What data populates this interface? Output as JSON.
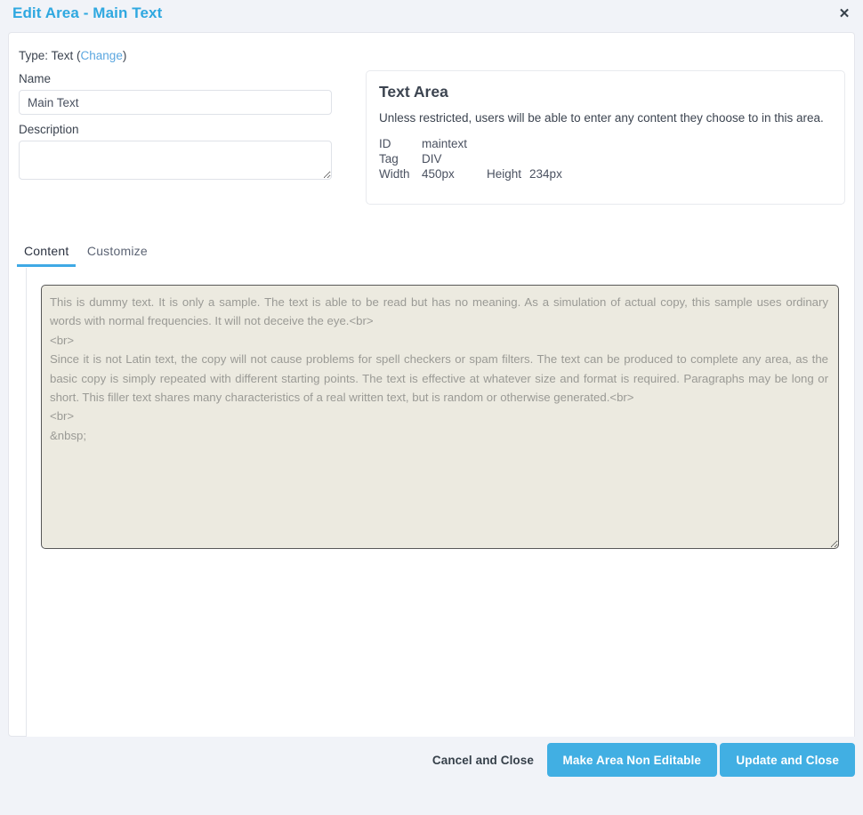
{
  "header": {
    "title": "Edit Area - Main Text",
    "close_icon": "close-icon",
    "close_glyph": "✕"
  },
  "form": {
    "type_prefix": "Type: Text (",
    "type_change_link": "Change",
    "type_suffix": ")",
    "name_label": "Name",
    "name_value": "Main Text",
    "name_placeholder": "",
    "description_label": "Description",
    "description_value": "",
    "description_placeholder": ""
  },
  "info": {
    "title": "Text Area",
    "description": "Unless restricted, users will be able to enter any content they choose to in this area.",
    "rows": [
      {
        "key": "ID",
        "value": "maintext",
        "key2": "",
        "value2": ""
      },
      {
        "key": "Tag",
        "value": "DIV",
        "key2": "",
        "value2": ""
      },
      {
        "key": "Width",
        "value": "450px",
        "key2": "Height",
        "value2": "234px"
      }
    ]
  },
  "tabs": [
    {
      "label": "Content",
      "active": true
    },
    {
      "label": "Customize",
      "active": false
    }
  ],
  "content": {
    "textarea_value": "This is dummy text. It is only a sample. The text is able to be read but has no meaning. As a simulation of actual copy, this sample uses ordinary words with normal frequencies. It will not deceive the eye.<br>\n<br>\nSince it is not Latin text, the copy will not cause problems for spell checkers or spam filters. The text can be produced to complete any area, as the basic copy is simply repeated with different starting points. The text is effective at whatever size and format is required. Paragraphs may be long or short. This filler text shares many characteristics of a real written text, but is random or otherwise generated.<br>\n<br>\n&nbsp;",
    "textarea_placeholder": ""
  },
  "footer": {
    "cancel_label": "Cancel and Close",
    "non_editable_label": "Make Area Non Editable",
    "update_label": "Update and Close"
  },
  "colors": {
    "accent": "#2fa8e0",
    "button": "#41afe3",
    "page_bg": "#f1f3f8",
    "textarea_bg": "#eceae0",
    "text": "#3c4450"
  }
}
